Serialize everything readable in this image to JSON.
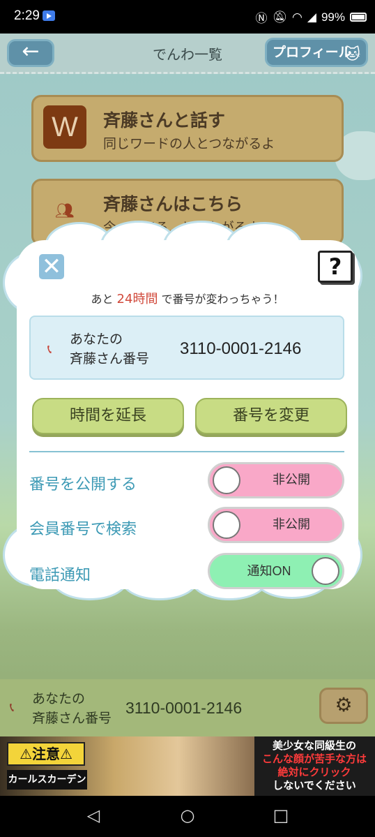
{
  "status_bar": {
    "time": "2:29",
    "battery": "99%",
    "icons": [
      "youtube-icon",
      "nfc-icon",
      "mute-icon",
      "wifi-icon",
      "signal-icon",
      "battery-icon"
    ]
  },
  "header": {
    "back_icon": "←",
    "title": "でんわ一覧",
    "profile_label": "プロフィール"
  },
  "menu": [
    {
      "icon_text": "W",
      "title": "斉藤さんと話す",
      "subtitle": "同じワードの人とつながるよ"
    },
    {
      "icon_text": "",
      "title": "斉藤さんはこちら",
      "subtitle": "今...なてる...とつながるよ"
    }
  ],
  "modal": {
    "close_icon": "✕",
    "help_icon": "?",
    "notice_prefix": "あと",
    "notice_highlight": "24時間",
    "notice_suffix": "で番号が変わっちゃう！",
    "number_label_line1": "あなたの",
    "number_label_line2": "斉藤さん番号",
    "number_value": "3110-0001-2146",
    "extend_button": "時間を延長",
    "change_button": "番号を変更",
    "settings": [
      {
        "label": "番号を公開する",
        "state": "非公開",
        "on": false
      },
      {
        "label": "会員番号で検索",
        "state": "非公開",
        "on": false
      },
      {
        "label": "電話通知",
        "state": "通知ON",
        "on": true
      }
    ],
    "colors": {
      "highlight": "#d14a3c",
      "toggle_off": "#f9a8c8",
      "toggle_on": "#8ef0b3",
      "label": "#3d9ab5"
    }
  },
  "footer": {
    "label_line1": "あなたの",
    "label_line2": "斉藤さん番号",
    "number_value": "3110-0001-2146"
  },
  "ad": {
    "warning": "⚠注意⚠",
    "brand": "カールスカーデン",
    "line1": "美少女な同級生の",
    "line2": "こんな顔が苦手な方は",
    "line3": "絶対にクリック",
    "line4": "しないでください"
  },
  "navbar": {
    "back": "◁",
    "home": "○",
    "recents": "□"
  }
}
